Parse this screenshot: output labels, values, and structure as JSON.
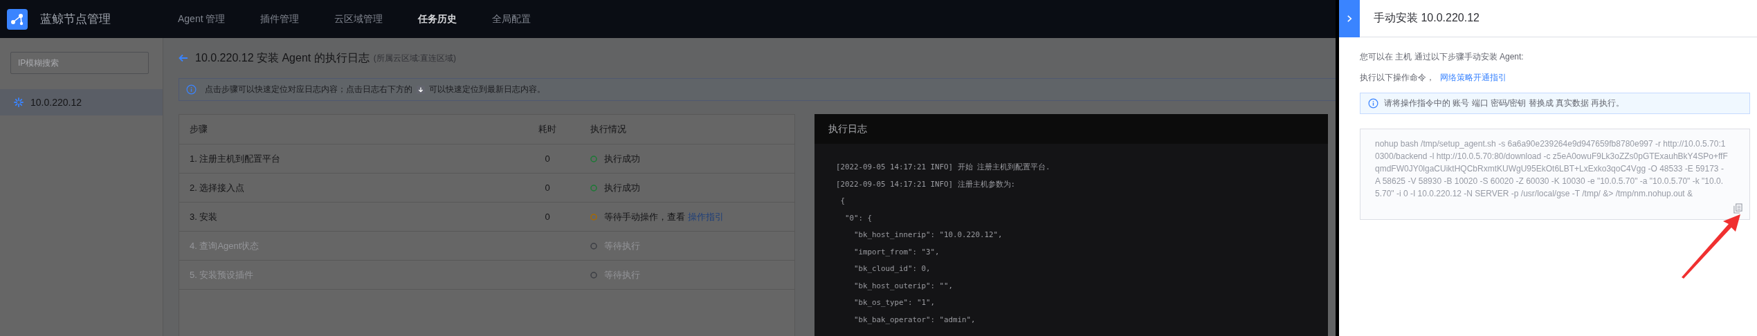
{
  "nav": {
    "logo_text": "蓝鲸节点管理",
    "items": [
      {
        "label": "Agent 管理",
        "selected": false
      },
      {
        "label": "插件管理",
        "selected": false
      },
      {
        "label": "云区域管理",
        "selected": false
      },
      {
        "label": "任务历史",
        "selected": true
      },
      {
        "label": "全局配置",
        "selected": false
      }
    ]
  },
  "sidebar": {
    "search": {
      "placeholder": "IP模糊搜索"
    },
    "items": [
      {
        "label": "10.0.220.12",
        "selected": true
      }
    ]
  },
  "page": {
    "title": "10.0.220.12 安装 Agent 的执行日志",
    "subtitle": "(所属云区域:直连区域)",
    "notice_before": "点击步骤可以快速定位对应日志内容；点击日志右下方的",
    "notice_after": "可以快速定位到最新日志内容。"
  },
  "table": {
    "columns": [
      "步骤",
      "耗时",
      "执行情况"
    ],
    "rows": [
      {
        "step": "1. 注册主机到配置平台",
        "duration": "0",
        "status": "执行成功",
        "kind": "success",
        "disabled": false
      },
      {
        "step": "2. 选择接入点",
        "duration": "0",
        "status": "执行成功",
        "kind": "success",
        "disabled": false
      },
      {
        "step": "3. 安装",
        "duration": "0",
        "status": "等待手动操作，查看",
        "link": "操作指引",
        "kind": "waiting",
        "disabled": false
      },
      {
        "step": "4. 查询Agent状态",
        "status": "等待执行",
        "kind": "pending",
        "disabled": true
      },
      {
        "step": "5. 安装预设插件",
        "status": "等待执行",
        "kind": "pending",
        "disabled": true
      }
    ]
  },
  "log": {
    "title": "执行日志",
    "lines": [
      "[2022-09-05 14:17:21 INFO] 开始 注册主机到配置平台.",
      "[2022-09-05 14:17:21 INFO] 注册主机参数为:",
      " {",
      "  \"0\": {",
      "    \"bk_host_innerip\": \"10.0.220.12\",",
      "    \"import_from\": \"3\",",
      "    \"bk_cloud_id\": 0,",
      "    \"bk_host_outerip\": \"\",",
      "    \"bk_os_type\": \"1\",",
      "    \"bk_bak_operator\": \"admin\","
    ]
  },
  "drawer": {
    "title": "手动安装 10.0.220.12",
    "intro": "您可以在 主机 通过以下步骤手动安装 Agent:",
    "step_text": "执行以下操作命令，",
    "step_link": "网络策略开通指引",
    "alert": "请将操作指令中的 账号 端口 密码/密钥 替换成 真实数据 再执行。",
    "command": "nohup bash /tmp/setup_agent.sh -s 6a6a90e239264e9d947659fb8780e997 -r http://10.0.5.70:10300/backend -l http://10.0.5.70:80/download -c z5eA0owuF9Lk3oZZs0pGTExauhBkY4SPo+ffFqmdFW0JY0lgaCUiktHQCbRxmtKUWgU95EkOt6LBT+LxExko3qoC4Vgg -O 48533 -E 59173 -A 58625 -V 58930 -B 10020 -S 60020 -Z 60030 -K 10030 -e \"10.0.5.70\" -a \"10.0.5.70\" -k \"10.0.5.70\" -i 0 -I 10.0.220.12 -N SERVER -p /usr/local/gse -T /tmp/ &> /tmp/nm.nohup.out &"
  }
}
